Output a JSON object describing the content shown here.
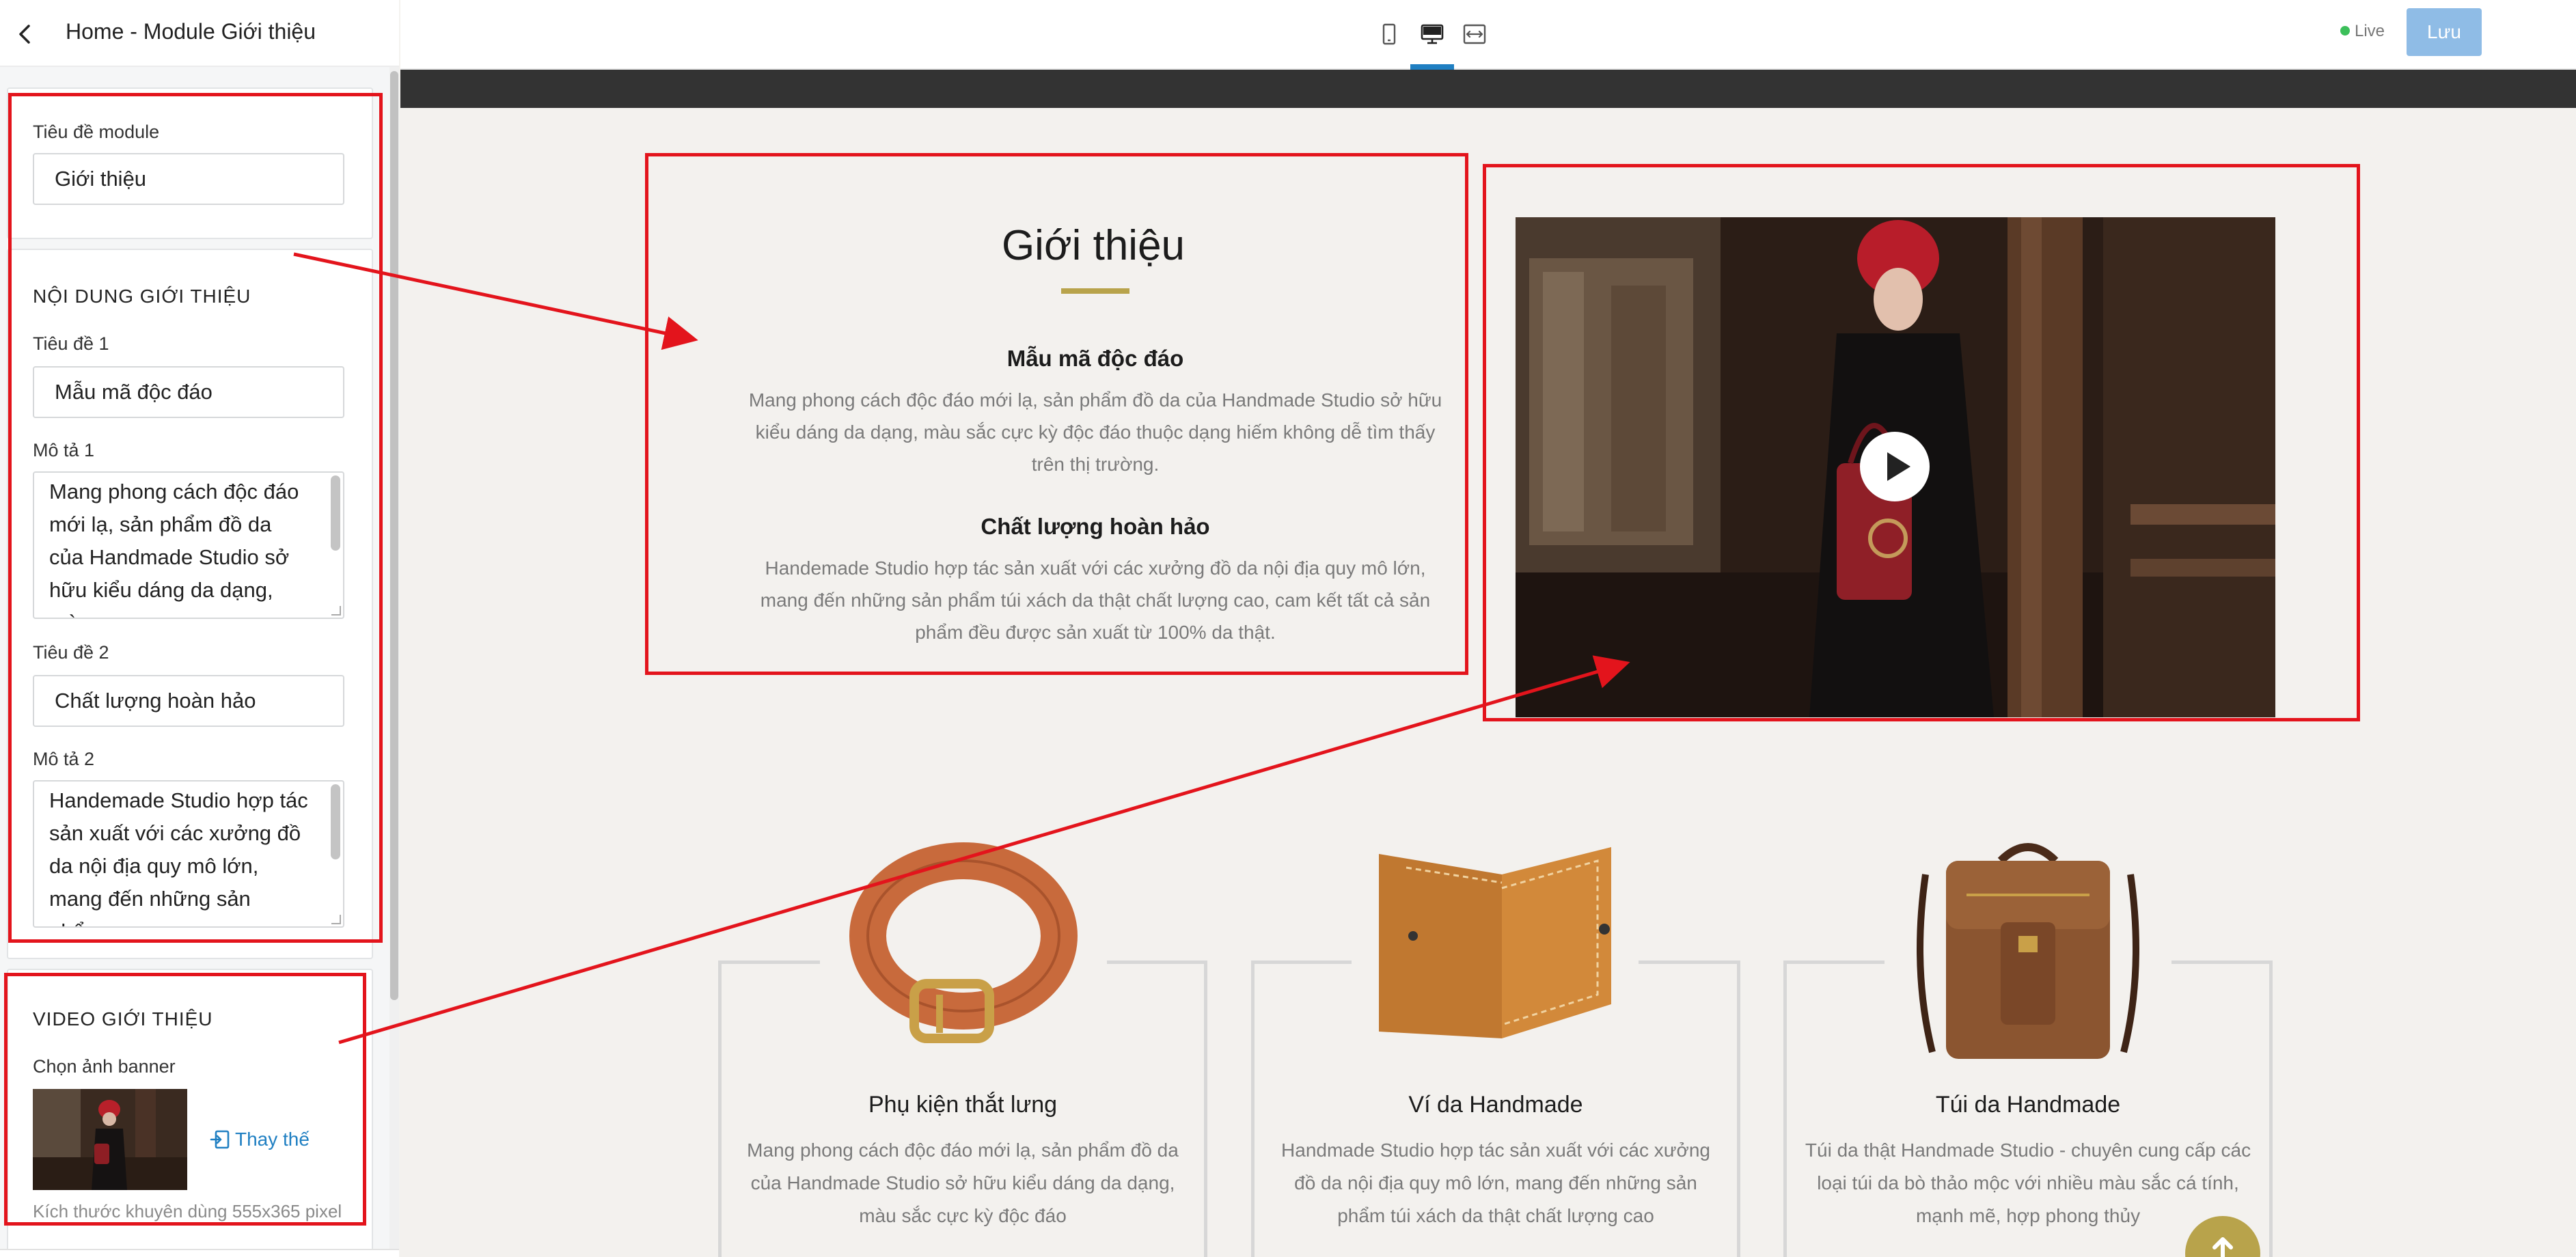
{
  "editor": {
    "title": "Home - Module Giới thiệu",
    "module_title_label": "Tiêu đề module",
    "module_title_value": "Giới thiệu",
    "content_section_heading": "NỘI DUNG GIỚI THIỆU",
    "heading1_label": "Tiêu đề 1",
    "heading1_value": "Mẫu mã độc đáo",
    "desc1_label": "Mô tả 1",
    "desc1_value": "Mang phong cách độc đáo mới lạ, sản phẩm đồ da của Handmade Studio sở hữu kiểu dáng da dạng, màu",
    "heading2_label": "Tiêu đề 2",
    "heading2_value": "Chất lượng hoàn hảo",
    "desc2_label": "Mô tả 2",
    "desc2_value": "Handemade Studio hợp tác sản xuất với các xưởng đồ da nội địa quy mô lớn, mang đến những sản phẩm",
    "video_section_heading": "VIDEO GIỚI THIỆU",
    "banner_label": "Chọn ảnh banner",
    "replace_label": "Thay thế",
    "size_hint": "Kích thước khuyên dùng 555x365 pixel"
  },
  "topbar": {
    "devices": [
      "mobile-icon",
      "desktop-icon",
      "fullwidth-icon"
    ],
    "active_device": "desktop",
    "live_label": "Live",
    "save_label": "Lưu"
  },
  "preview": {
    "section_title": "Giới thiệu",
    "feature1_title": "Mẫu mã độc đáo",
    "feature1_text": "Mang phong cách độc đáo mới lạ, sản phẩm đồ da của Handmade Studio sở hữu kiểu dáng da dạng, màu sắc cực kỳ độc đáo thuộc dạng hiếm không dễ tìm thấy trên thị trường.",
    "feature2_title": "Chất lượng hoàn hảo",
    "feature2_text": "Handemade Studio hợp tác sản xuất với các xưởng đồ da nội địa quy mô lớn, mang đến những sản phẩm túi xách da thật chất lượng cao, cam kết tất cả sản phẩm đều được sản xuất từ 100% da thật.",
    "products": [
      {
        "title": "Phụ kiện thắt lưng",
        "desc": "Mang phong cách độc đáo mới lạ, sản phẩm đồ da của Handmade Studio sở hữu kiểu dáng da dạng, màu sắc cực kỳ độc đáo"
      },
      {
        "title": "Ví da Handmade",
        "desc": "Handmade Studio hợp tác sản xuất với các xưởng đồ da nội địa quy mô lớn, mang đến những sản phẩm túi xách da thật chất lượng cao"
      },
      {
        "title": "Túi da Handmade",
        "desc": "Túi da thật Handmade Studio - chuyên cung cấp các loại túi da bò thảo mộc với nhiều màu sắc cá tính, mạnh mẽ, hợp phong thủy"
      }
    ]
  },
  "colors": {
    "accent_blue": "#1f7fc2",
    "gold": "#b8a34b",
    "annotation_red": "#e3141c",
    "live_green": "#3cbf5a"
  }
}
